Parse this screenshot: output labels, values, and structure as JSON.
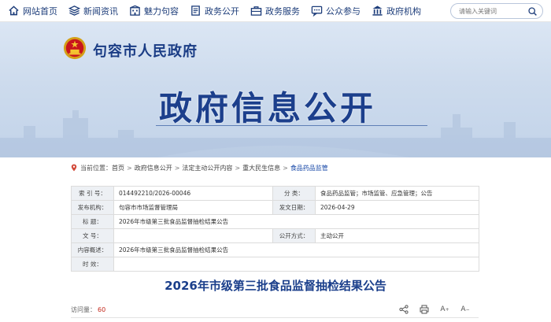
{
  "nav": {
    "items": [
      {
        "label": "网站首页",
        "icon": "home-icon"
      },
      {
        "label": "新闻资讯",
        "icon": "layers-icon"
      },
      {
        "label": "魅力句容",
        "icon": "building-icon"
      },
      {
        "label": "政务公开",
        "icon": "document-icon"
      },
      {
        "label": "政务服务",
        "icon": "briefcase-icon"
      },
      {
        "label": "公众参与",
        "icon": "chat-icon"
      },
      {
        "label": "政府机构",
        "icon": "institution-icon"
      }
    ],
    "search_placeholder": "请输入关键词"
  },
  "banner": {
    "gov_name": "句容市人民政府",
    "big_title": "政府信息公开"
  },
  "breadcrumb": {
    "prefix": "当前位置：",
    "items": [
      "首页",
      "政府信息公开",
      "法定主动公开内容",
      "重大民生信息",
      "食品药品监管"
    ]
  },
  "info": {
    "r1": {
      "k1": "索 引 号：",
      "v1": "014492210/2026-00046",
      "k2": "分    类：",
      "v2": "食品药品监管；市场监管、应急管理；公告"
    },
    "r2": {
      "k1": "发布机构：",
      "v1": "句容市市场监督管理局",
      "k2": "发文日期：",
      "v2": "2026-04-29"
    },
    "r3": {
      "k1": "标    题：",
      "v1": "2026年市级第三批食品监督抽检结果公告"
    },
    "r4": {
      "k1": "文    号：",
      "v1": "",
      "k2": "公开方式：",
      "v2": "主动公开"
    },
    "r5": {
      "k1": "内容概述：",
      "v1": "2026年市级第三批食品监督抽检结果公告"
    },
    "r6": {
      "k1": "时    效：",
      "v1": ""
    }
  },
  "article": {
    "title": "2026年市级第三批食品监督抽检结果公告",
    "views_label": "访问量：",
    "views": "60",
    "font_large": "A",
    "font_small": "A"
  }
}
